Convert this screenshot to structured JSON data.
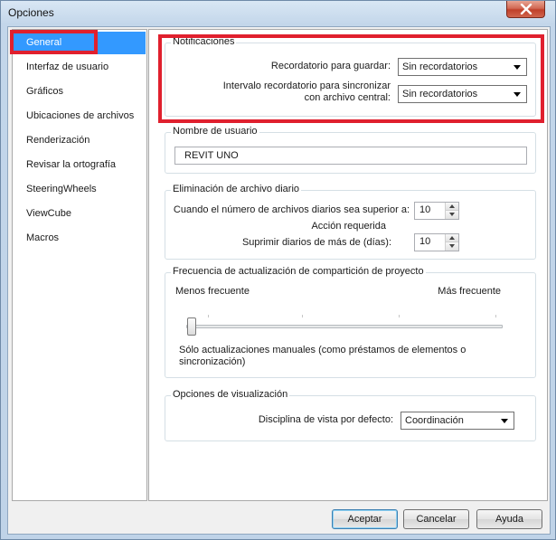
{
  "window": {
    "title": "Opciones"
  },
  "sidebar": {
    "items": [
      {
        "label": "General",
        "selected": true
      },
      {
        "label": "Interfaz de usuario"
      },
      {
        "label": "Gráficos"
      },
      {
        "label": "Ubicaciones de archivos"
      },
      {
        "label": "Renderización"
      },
      {
        "label": "Revisar la ortografía"
      },
      {
        "label": "SteeringWheels"
      },
      {
        "label": "ViewCube"
      },
      {
        "label": "Macros"
      }
    ]
  },
  "notifications": {
    "title": "Notificaciones",
    "save_reminder_label": "Recordatorio para guardar:",
    "save_reminder_value": "Sin recordatorios",
    "sync_reminder_label_line1": "Intervalo recordatorio para sincronizar",
    "sync_reminder_label_line2": "con archivo central:",
    "sync_reminder_value": "Sin recordatorios"
  },
  "username": {
    "title": "Nombre de usuario",
    "value": "REVIT  UNO"
  },
  "journal": {
    "title": "Eliminación de archivo diario",
    "exceeds_label": "Cuando el número de archivos diarios sea superior a:",
    "exceeds_value": "10",
    "action_label": "Acción requerida",
    "delete_label": "Suprimir diarios de más de (días):",
    "delete_value": "10"
  },
  "sync_frequency": {
    "title": "Frecuencia de actualización de compartición de proyecto",
    "less_label": "Menos frecuente",
    "more_label": "Más frecuente",
    "slider_position": 0,
    "description_line1": "Sólo actualizaciones manuales (como préstamos de elementos o",
    "description_line2": "sincronización)"
  },
  "view_options": {
    "title": "Opciones de visualización",
    "discipline_label": "Disciplina de vista por defecto:",
    "discipline_value": "Coordinación"
  },
  "buttons": {
    "ok": "Aceptar",
    "cancel": "Cancelar",
    "help": "Ayuda"
  },
  "colors": {
    "selection": "#3399ff",
    "highlight_box": "#e0202e",
    "close_button": "#c0402a"
  }
}
